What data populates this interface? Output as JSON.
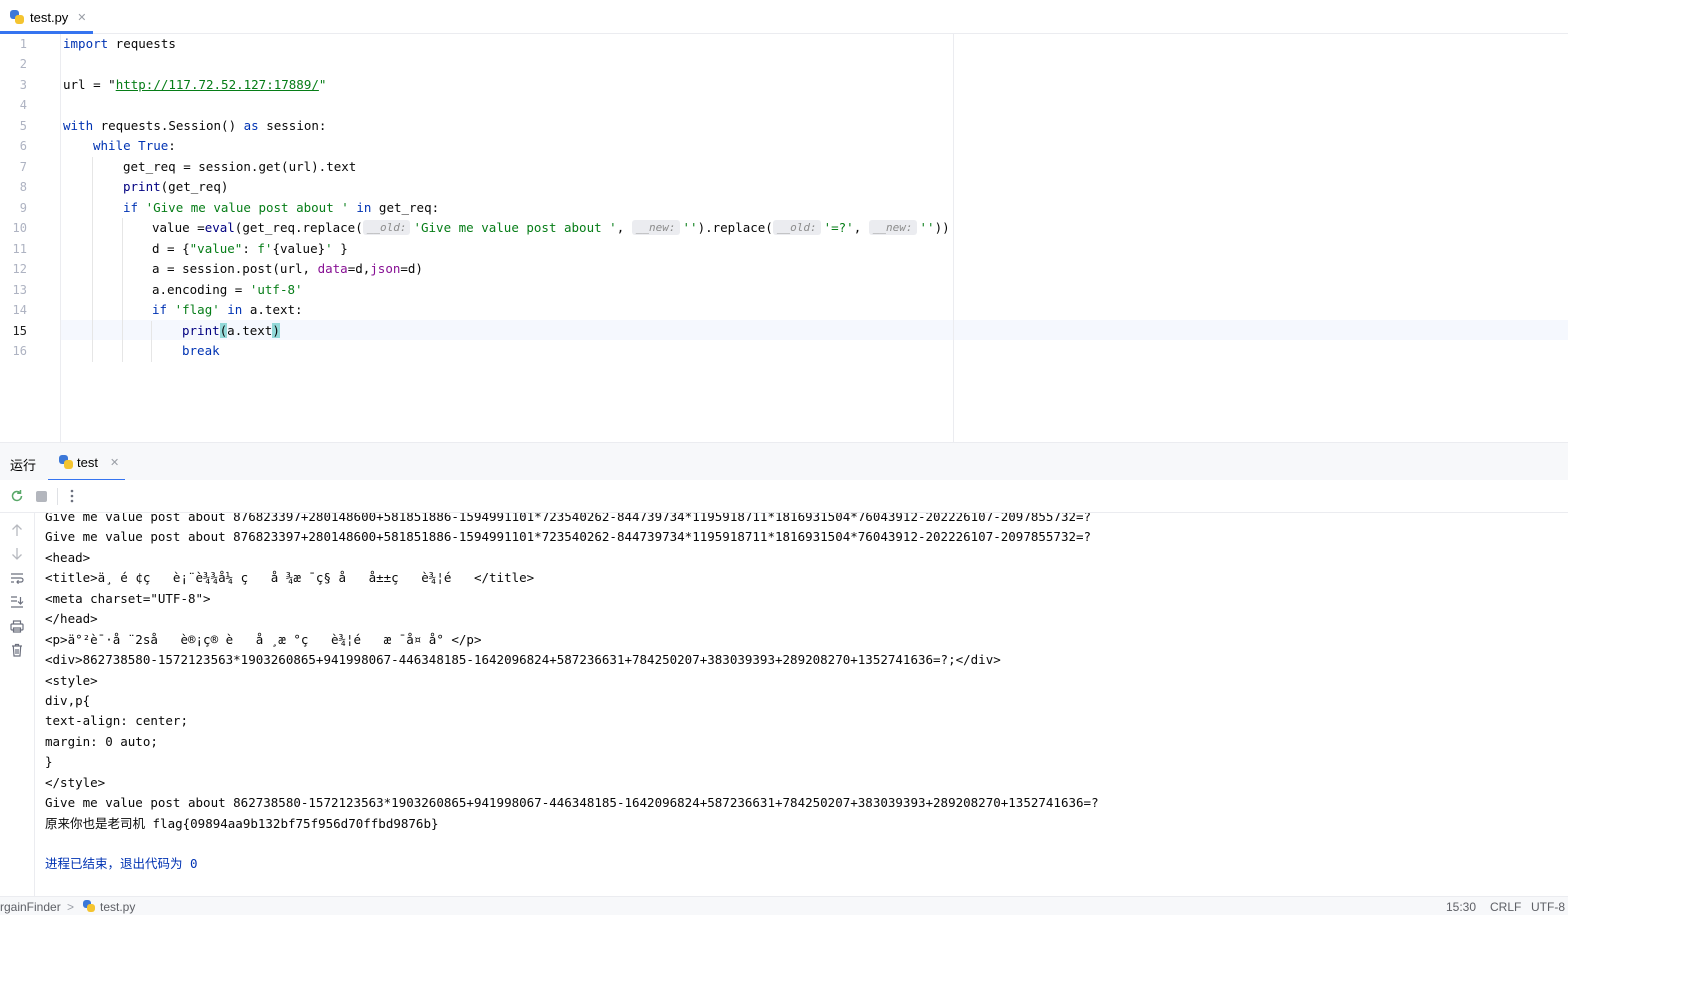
{
  "editor_tab": {
    "filename": "test.py",
    "close": "✕"
  },
  "editor": {
    "line_numbers": [
      "1",
      "2",
      "3",
      "4",
      "5",
      "6",
      "7",
      "8",
      "9",
      "10",
      "11",
      "12",
      "13",
      "14",
      "15",
      "16"
    ],
    "line1": {
      "kw": "import",
      "rest": " requests"
    },
    "line3": {
      "a": "url = \"",
      "url": "http://117.72.52.127:17889/",
      "b": "\""
    },
    "line5": {
      "kw1": "with",
      "a": " requests.Session() ",
      "kw2": "as",
      "b": " session:"
    },
    "line6": {
      "kw": "while",
      "sp": " ",
      "kw2": "True",
      "colon": ":"
    },
    "line7": {
      "text": "get_req = session.get(url).text"
    },
    "line8": {
      "fn": "print",
      "rest": "(get_req)"
    },
    "line9": {
      "kw": "if",
      "sp": " ",
      "str": "'Give me value post about '",
      "sp2": " ",
      "kw2": "in",
      "rest": " get_req:"
    },
    "line10": {
      "a": "value =",
      "fn": "eval",
      "b": "(get_req.replace(",
      "hint1": "__old:",
      "s1": "'Give me value post about '",
      "c": ", ",
      "hint2": "__new:",
      "s2": "''",
      "d": ").replace(",
      "hint3": "__old:",
      "s3": "'=?'",
      "e": ", ",
      "hint4": "__new:",
      "s4": "''",
      "f": "))"
    },
    "line11": {
      "a": "d = {",
      "s1": "\"value\"",
      "b": ": ",
      "s2": "f'",
      "c": "{value}",
      "s3": "'",
      "d": " }"
    },
    "line12": {
      "a": "a = session.post(url, ",
      "p1": "data",
      "b": "=d,",
      "p2": "json",
      "c": "=d)"
    },
    "line13": {
      "a": "a.encoding = ",
      "s": "'utf-8'"
    },
    "line14": {
      "kw": "if",
      "sp": " ",
      "s": "'flag'",
      "sp2": " ",
      "kw2": "in",
      "rest": " a.text:"
    },
    "line15": {
      "fn": "print",
      "p1": "(",
      "mid": "a.text",
      "p2": ")"
    },
    "line16": {
      "kw": "break"
    }
  },
  "run_panel": {
    "title": "运行",
    "tab_label": "test",
    "tab_close": "✕",
    "console_lines": [
      "Give me value post about 876823397+280148600+581851886-1594991101*723540262-844739734*1195918711*1816931504*76043912-202226107-2097855732=?",
      "Give me value post about 876823397+280148600+581851886-1594991101*723540262-844739734*1195918711*1816931504*76043912-202226107-2097855732=?",
      "<head>",
      "<title>ä¸ é ¢ç   è¡¨è¾¾å¼ ç   å ¾æ ¯ç§ å   å±±ç   è¾¦é   </title>",
      "<meta charset=\"UTF-8\">",
      "</head>",
      "<p>ä°²è¯·å ¨2så   è®¡ç® è   å ¸æ °ç   è¾¦é   æ ¯å¤ å° </p>",
      "<div>862738580-1572123563*1903260865+941998067-446348185-1642096824+587236631+784250207+383039393+289208270+1352741636=?;</div>",
      "<style>",
      "div,p{",
      "text-align: center;",
      "margin: 0 auto;",
      "}",
      "</style>",
      "Give me value post about 862738580-1572123563*1903260865+941998067-446348185-1642096824+587236631+784250207+383039393+289208270+1352741636=?",
      "原来你也是老司机 flag{09894aa9b132bf75f956d70ffbd9876b}",
      "",
      "进程已结束，退出代码为 0"
    ]
  },
  "status_bar": {
    "project": "rgainFinder",
    "separator": ">",
    "file": "test.py",
    "position": "15:30",
    "line_ending": "CRLF",
    "encoding": "UTF-8"
  },
  "colors": {
    "accent": "#3574f0",
    "keyword": "#0033b3",
    "string": "#067d17",
    "parameter": "#871094"
  }
}
